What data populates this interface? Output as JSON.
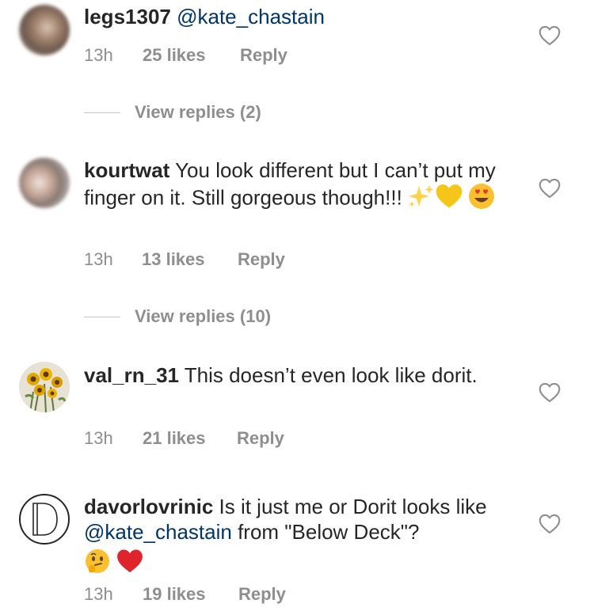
{
  "comments": [
    {
      "username": "legs1307",
      "segments": [
        " ",
        "@kate_chastain"
      ],
      "time": "13h",
      "likes": "25 likes",
      "reply": "Reply",
      "view_replies": "View replies (2)"
    },
    {
      "username": "kourtwat",
      "text": " You look different but I can’t put my finger on it. Still gorgeous though!!! ",
      "time": "13h",
      "likes": "13 likes",
      "reply": "Reply",
      "view_replies": "View replies (10)"
    },
    {
      "username": "val_rn_31",
      "text": " This doesn’t even look like dorit.",
      "time": "13h",
      "likes": "21 likes",
      "reply": "Reply"
    },
    {
      "username": "davorlovrinic",
      "text_before": " Is it just me or Dorit looks like ",
      "mention": "@kate_chastain",
      "text_after": " from \"Below Deck\"?",
      "time": "13h",
      "likes": "19 likes",
      "reply": "Reply"
    }
  ],
  "colors": {
    "text": "#262626",
    "muted": "#8e8e8e",
    "mention": "#003569"
  },
  "icons": {
    "like": "heart-outline-icon",
    "sparkles": "sparkles-emoji",
    "yellow_heart": "yellow-heart-emoji",
    "heart_eyes": "heart-eyes-emoji",
    "thinking": "thinking-face-emoji",
    "red_heart": "red-heart-emoji"
  }
}
